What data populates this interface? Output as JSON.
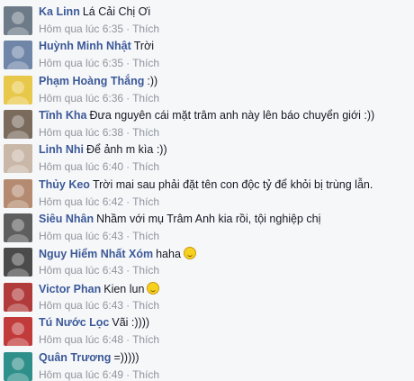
{
  "comments": [
    {
      "author": "Ka Linn",
      "text": "Lá Cải Chị Ơi",
      "time": "Hôm qua lúc 6:35",
      "like": "Thích",
      "avatar_color": "#6d7a87",
      "emoji": false
    },
    {
      "author": "Huỳnh Minh Nhật",
      "text": "Trời",
      "time": "Hôm qua lúc 6:35",
      "like": "Thích",
      "avatar_color": "#6f86a8",
      "emoji": false
    },
    {
      "author": "Phạm Hoàng Thắng",
      "text": ":))",
      "time": "Hôm qua lúc 6:36",
      "like": "Thích",
      "avatar_color": "#e8c84a",
      "emoji": false
    },
    {
      "author": "Tĩnh Kha",
      "text": "Đưa nguyên cái mặt trâm anh này lên báo chuyển giới :))",
      "time": "Hôm qua lúc 6:38",
      "like": "Thích",
      "avatar_color": "#7a6b5d",
      "emoji": false
    },
    {
      "author": "Linh Nhi",
      "text": "Để ảnh m kìa :))",
      "time": "Hôm qua lúc 6:40",
      "like": "Thích",
      "avatar_color": "#c9b7a8",
      "emoji": false
    },
    {
      "author": "Thủy Keo",
      "text": "Trời mai sau phải đặt tên con độc tỷ để khỏi bị trùng lẫn.",
      "time": "Hôm qua lúc 6:42",
      "like": "Thích",
      "avatar_color": "#b48a70",
      "emoji": false
    },
    {
      "author": "Siêu Nhân",
      "text": "Nhầm với mụ Trâm Anh kia rồi, tội nghiệp chị",
      "time": "Hôm qua lúc 6:43",
      "like": "Thích",
      "avatar_color": "#5e5e5e",
      "emoji": false
    },
    {
      "author": "Nguy Hiểm Nhất Xóm",
      "text": "haha",
      "time": "Hôm qua lúc 6:43",
      "like": "Thích",
      "avatar_color": "#4b4b4b",
      "emoji": true
    },
    {
      "author": "Victor Phan",
      "text": "Kien lun",
      "time": "Hôm qua lúc 6:43",
      "like": "Thích",
      "avatar_color": "#b13a3a",
      "emoji": true
    },
    {
      "author": "Tú Nước Lọc",
      "text": "Vãi :))))",
      "time": "Hôm qua lúc 6:48",
      "like": "Thích",
      "avatar_color": "#c23b3b",
      "emoji": false
    },
    {
      "author": "Quân Trương",
      "text": "=)))))",
      "time": "Hôm qua lúc 6:49",
      "like": "Thích",
      "avatar_color": "#2f8f8a",
      "emoji": false
    }
  ]
}
